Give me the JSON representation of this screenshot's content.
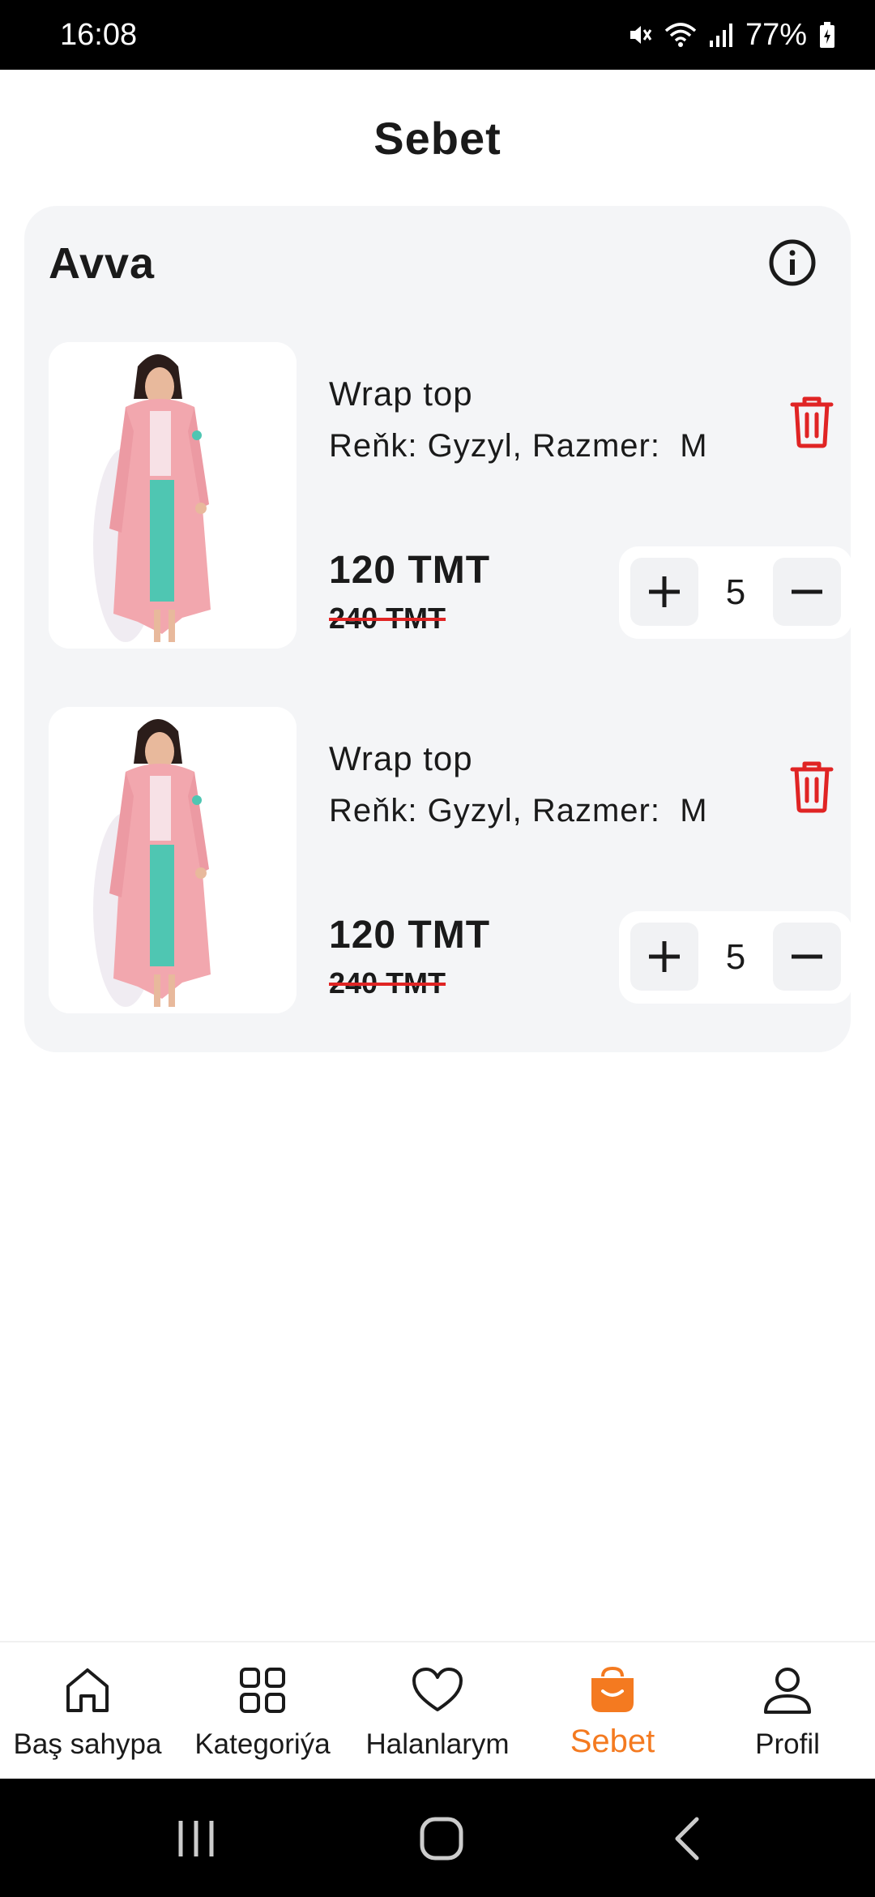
{
  "status_bar": {
    "time": "16:08",
    "battery": "77%"
  },
  "page_title": "Sebet",
  "store": {
    "name": "Avva",
    "items": [
      {
        "name": "Wrap top",
        "variant": "Reňk: Gyzyl, Razmer:  M",
        "price": "120 TMT",
        "old_price": "240 TMT",
        "quantity": "5"
      },
      {
        "name": "Wrap top",
        "variant": "Reňk: Gyzyl, Razmer:  M",
        "price": "120 TMT",
        "old_price": "240 TMT",
        "quantity": "5"
      }
    ]
  },
  "bottom_nav": {
    "items": [
      {
        "label": "Baş sahypa",
        "icon": "home-icon"
      },
      {
        "label": "Kategoriýa",
        "icon": "grid-icon"
      },
      {
        "label": "Halanlarym",
        "icon": "heart-icon"
      },
      {
        "label": "Sebet",
        "icon": "basket-icon",
        "active": true
      },
      {
        "label": "Profil",
        "icon": "user-icon"
      }
    ]
  },
  "colors": {
    "accent": "#f47a20",
    "delete": "#e02424",
    "card_bg": "#f4f5f7"
  }
}
